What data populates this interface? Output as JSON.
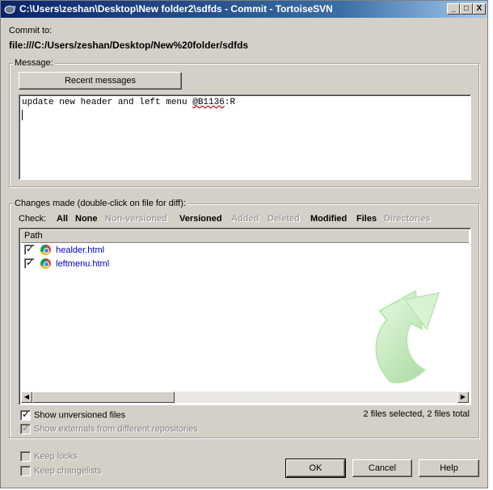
{
  "window": {
    "title": "C:\\Users\\zeshan\\Desktop\\New folder2\\sdfds - Commit - TortoiseSVN",
    "minimize_glyph": "_",
    "maximize_glyph": "□",
    "close_glyph": "X"
  },
  "commit_to": {
    "label": "Commit to:",
    "url": "file:///C:/Users/zeshan/Desktop/New%20folder/sdfds"
  },
  "message": {
    "group_label": "Message:",
    "recent_button": "Recent messages",
    "text_plain": "update new header and left menu ",
    "text_flagged": "@B1136",
    "text_tail": ":R"
  },
  "changes": {
    "group_label": "Changes made (double-click on file for diff):",
    "check_label": "Check:",
    "filters": [
      {
        "label": "All",
        "enabled": true
      },
      {
        "label": "None",
        "enabled": true
      },
      {
        "label": "Non-versioned",
        "enabled": false
      },
      {
        "label": "Versioned",
        "enabled": true
      },
      {
        "label": "Added",
        "enabled": false
      },
      {
        "label": "Deleted",
        "enabled": false
      },
      {
        "label": "Modified",
        "enabled": true
      },
      {
        "label": "Files",
        "enabled": true
      },
      {
        "label": "Directories",
        "enabled": false
      }
    ],
    "column_path": "Path",
    "files": [
      {
        "name": "healder.html",
        "checked": true,
        "icon": "chrome-html-file-icon"
      },
      {
        "name": "leftmenu.html",
        "checked": true,
        "icon": "chrome-html-file-icon"
      }
    ],
    "show_unversioned": {
      "label": "Show unversioned files",
      "checked": true
    },
    "show_externals": {
      "label": "Show externals from different repositories",
      "checked": true,
      "enabled": false
    },
    "selection_status": "2 files selected, 2 files total"
  },
  "options": {
    "keep_locks": {
      "label": "Keep locks",
      "checked": false
    },
    "keep_changelists": {
      "label": "Keep changelists",
      "checked": false
    }
  },
  "buttons": {
    "ok": "OK",
    "cancel": "Cancel",
    "help": "Help"
  },
  "colors": {
    "dialog_bg": "#d4d0c8",
    "title_gradient_start": "#0a246a",
    "file_link": "#0000cc",
    "logo_green": "#c6efc0"
  },
  "scroll_glyphs": {
    "left": "◀",
    "right": "▶"
  }
}
